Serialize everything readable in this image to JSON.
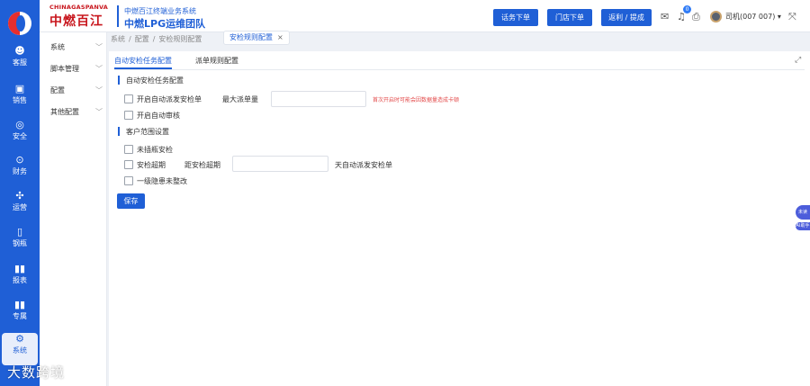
{
  "rail": {
    "items": [
      {
        "icon": "customer-icon",
        "label": "客服"
      },
      {
        "icon": "sales-icon",
        "label": "销售"
      },
      {
        "icon": "security-icon",
        "label": "安全"
      },
      {
        "icon": "finance-icon",
        "label": "财务"
      },
      {
        "icon": "operations-icon",
        "label": "运营"
      },
      {
        "icon": "cylinder-icon",
        "label": "钢瓶"
      },
      {
        "icon": "report-icon",
        "label": "报表"
      },
      {
        "icon": "special-icon",
        "label": "专属"
      },
      {
        "icon": "system-icon",
        "label": "系统"
      }
    ]
  },
  "header": {
    "brand_en": "CHINAGASPANVA",
    "brand_cn": "中燃百江",
    "system_name": "中燃百江终端业务系统",
    "team_name": "中燃LPG运维团队",
    "buttons": [
      "话务下单",
      "门店下单",
      "返利 / 提成"
    ],
    "notification_count": "0",
    "user": "司机(007 007)"
  },
  "menu": {
    "items": [
      "系统",
      "脚本管理",
      "配置",
      "其他配置"
    ]
  },
  "breadcrumb": [
    "系统",
    "/",
    "配置",
    "/",
    "安检规则配置"
  ],
  "page_tab": {
    "label": "安检规则配置",
    "close": "×"
  },
  "content": {
    "tabs": [
      "自动安检任务配置",
      "派单规则配置"
    ],
    "section1": {
      "title": "自动安检任务配置",
      "auto_dispatch_label": "开启自动派发安检单",
      "max_dispatch_label": "最大派单量",
      "max_dispatch_value": "",
      "hint": "首次开启时可能会因数据量造成卡顿",
      "auto_review_label": "开启自动审核"
    },
    "section2": {
      "title": "客户范围设置",
      "unbound_label": "未插瓶安检",
      "overdue_label": "安检超期",
      "distance_label": "距安检超期",
      "distance_value": "",
      "distance_suffix": "天自动派发安检单",
      "hazard_label": "一级隐患未整改"
    },
    "save_label": "保存"
  },
  "float": {
    "tab": "未读",
    "ai": "AI助手"
  },
  "watermark": "大数跨境",
  "colors": {
    "primary": "#1f5fd6",
    "brand_red": "#c8161d",
    "hint_red": "#e34b4b"
  }
}
